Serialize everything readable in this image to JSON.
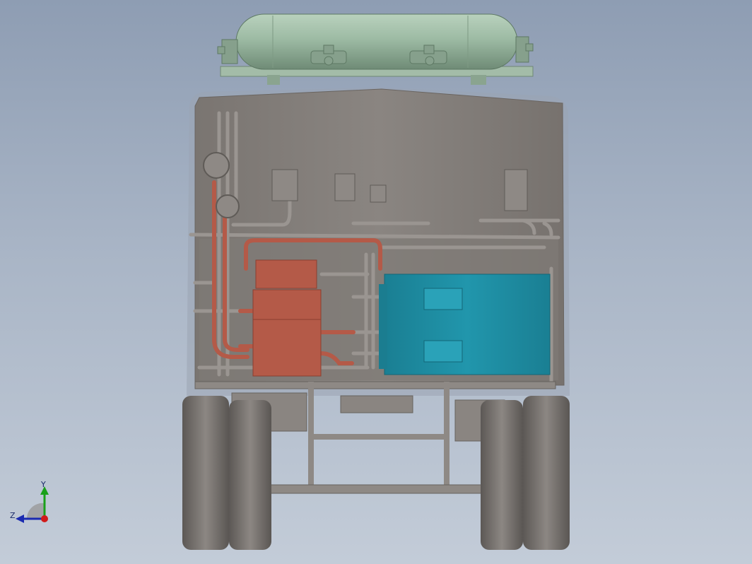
{
  "viewport": {
    "background_top": "#8e9db3",
    "background_bottom": "#c3ccd8",
    "model_parts": [
      "roof-gas-tank",
      "vehicle-body",
      "pipework",
      "heat-exchanger-unit",
      "storage-tank-unit",
      "chassis-frame",
      "rear-wheels"
    ]
  },
  "colors": {
    "tank": "#9dbba4",
    "body": "#85807b",
    "pipes_red": "#b45a48",
    "unit_cyan": "#1c8aa0",
    "wheels": "#6f6b67"
  },
  "triad": {
    "y_label": "Y",
    "z_label": "Z",
    "y_color": "#1aa01a",
    "z_color": "#1a2ab0",
    "x_color": "#d01a1a"
  }
}
